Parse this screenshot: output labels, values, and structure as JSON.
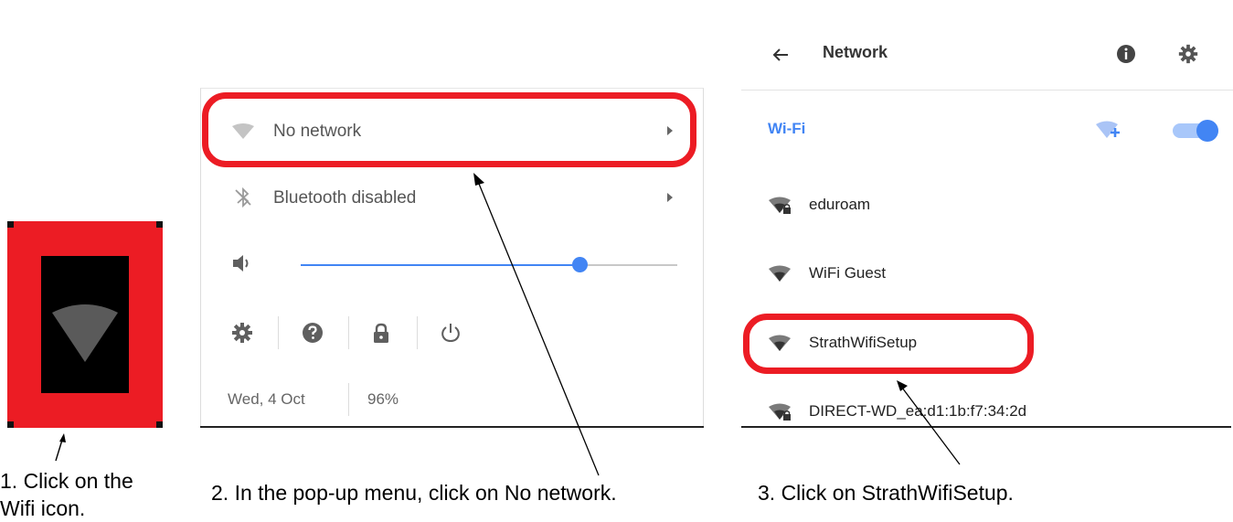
{
  "popup": {
    "network_label": "No network",
    "bluetooth_label": "Bluetooth disabled",
    "volume_fraction": 0.74,
    "date": "Wed, 4 Oct",
    "battery": "96%"
  },
  "network_panel": {
    "title": "Network",
    "wifi_label": "Wi-Fi",
    "wifi_enabled": true,
    "accent_color": "#4285f4",
    "networks": [
      {
        "name": "eduroam",
        "locked": true
      },
      {
        "name": "WiFi Guest",
        "locked": false
      },
      {
        "name": "StrathWifiSetup",
        "locked": false
      },
      {
        "name": "DIRECT-WD_ea:d1:1b:f7:34:2d",
        "locked": true
      }
    ]
  },
  "highlight_color": "#ec1c24",
  "captions": {
    "step1": "1. Click on the Wifi icon.",
    "step2": "2. In the pop-up menu, click on No network.",
    "step3": "3. Click on StrathWifiSetup."
  }
}
